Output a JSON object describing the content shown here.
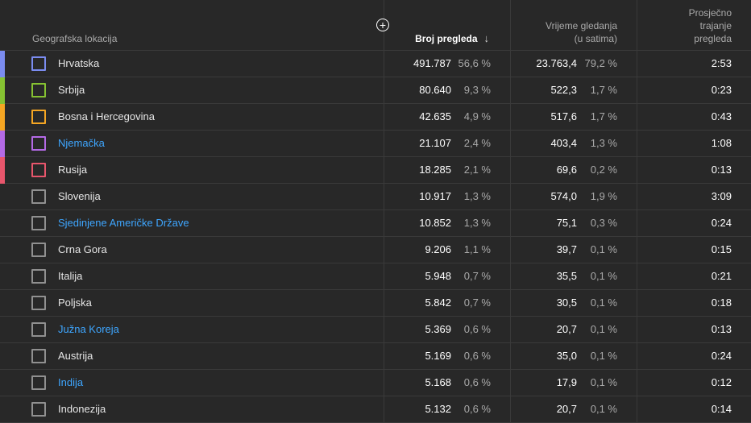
{
  "header": {
    "geo_label": "Geografska lokacija",
    "views_label": "Broj pregleda",
    "watch_label_line1": "Vrijeme gledanja",
    "watch_label_line2": "(u satima)",
    "avg_label_line1": "Prosječno",
    "avg_label_line2": "trajanje",
    "avg_label_line3": "pregleda",
    "add_column_icon": "plus-circle-icon",
    "sort_icon": "arrow-down-icon"
  },
  "rows": [
    {
      "country": "Hrvatska",
      "link": false,
      "color": "#7b8cf0",
      "views": "491.787",
      "views_pct": "56,6 %",
      "watch": "23.763,4",
      "watch_pct": "79,2 %",
      "avg": "2:53"
    },
    {
      "country": "Srbija",
      "link": false,
      "color": "#86c232",
      "views": "80.640",
      "views_pct": "9,3 %",
      "watch": "522,3",
      "watch_pct": "1,7 %",
      "avg": "0:23"
    },
    {
      "country": "Bosna i Hercegovina",
      "link": false,
      "color": "#f5a623",
      "views": "42.635",
      "views_pct": "4,9 %",
      "watch": "517,6",
      "watch_pct": "1,7 %",
      "avg": "0:43"
    },
    {
      "country": "Njemačka",
      "link": true,
      "color": "#b46ae6",
      "views": "21.107",
      "views_pct": "2,4 %",
      "watch": "403,4",
      "watch_pct": "1,3 %",
      "avg": "1:08"
    },
    {
      "country": "Rusija",
      "link": false,
      "color": "#e8566c",
      "views": "18.285",
      "views_pct": "2,1 %",
      "watch": "69,6",
      "watch_pct": "0,2 %",
      "avg": "0:13"
    },
    {
      "country": "Slovenija",
      "link": false,
      "color": "",
      "views": "10.917",
      "views_pct": "1,3 %",
      "watch": "574,0",
      "watch_pct": "1,9 %",
      "avg": "3:09"
    },
    {
      "country": "Sjedinjene Američke Države",
      "link": true,
      "color": "",
      "views": "10.852",
      "views_pct": "1,3 %",
      "watch": "75,1",
      "watch_pct": "0,3 %",
      "avg": "0:24"
    },
    {
      "country": "Crna Gora",
      "link": false,
      "color": "",
      "views": "9.206",
      "views_pct": "1,1 %",
      "watch": "39,7",
      "watch_pct": "0,1 %",
      "avg": "0:15"
    },
    {
      "country": "Italija",
      "link": false,
      "color": "",
      "views": "5.948",
      "views_pct": "0,7 %",
      "watch": "35,5",
      "watch_pct": "0,1 %",
      "avg": "0:21"
    },
    {
      "country": "Poljska",
      "link": false,
      "color": "",
      "views": "5.842",
      "views_pct": "0,7 %",
      "watch": "30,5",
      "watch_pct": "0,1 %",
      "avg": "0:18"
    },
    {
      "country": "Južna Koreja",
      "link": true,
      "color": "",
      "views": "5.369",
      "views_pct": "0,6 %",
      "watch": "20,7",
      "watch_pct": "0,1 %",
      "avg": "0:13"
    },
    {
      "country": "Austrija",
      "link": false,
      "color": "",
      "views": "5.169",
      "views_pct": "0,6 %",
      "watch": "35,0",
      "watch_pct": "0,1 %",
      "avg": "0:24"
    },
    {
      "country": "Indija",
      "link": true,
      "color": "",
      "views": "5.168",
      "views_pct": "0,6 %",
      "watch": "17,9",
      "watch_pct": "0,1 %",
      "avg": "0:12"
    },
    {
      "country": "Indonezija",
      "link": false,
      "color": "",
      "views": "5.132",
      "views_pct": "0,6 %",
      "watch": "20,7",
      "watch_pct": "0,1 %",
      "avg": "0:14"
    }
  ]
}
